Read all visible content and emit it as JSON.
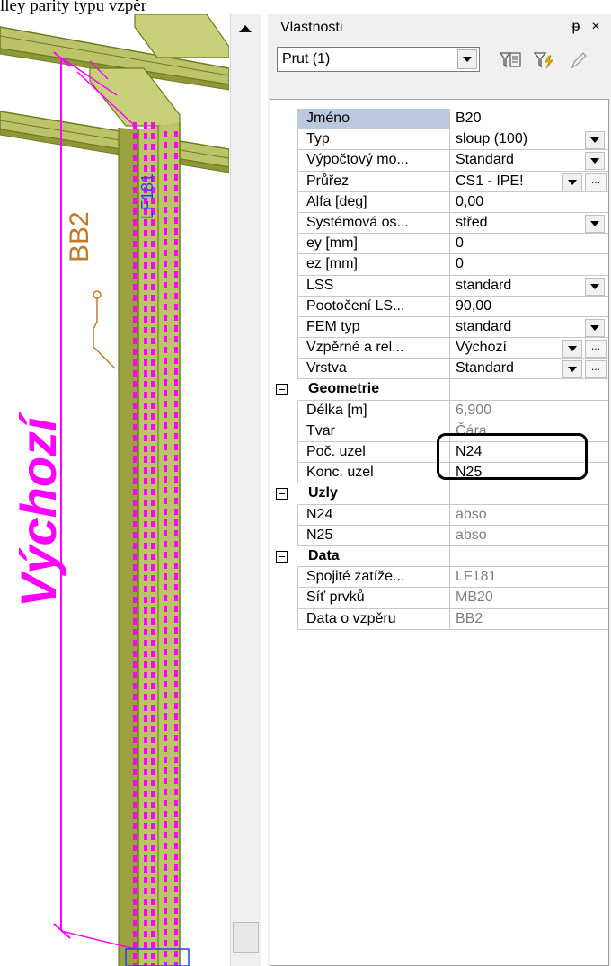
{
  "top_caption": "lley parity typu vzpěr",
  "viewport": {
    "labels": {
      "vychozi": "Výchozí",
      "bb2": "BB2",
      "lf181": "LF181"
    }
  },
  "panel": {
    "title": "Vlastnosti",
    "pin_glyph": "ᵽ",
    "close_glyph": "×",
    "selector_value": "Prut (1)",
    "toolbar_icons": [
      "filter-select-icon",
      "filter-lightning-icon",
      "pencil-icon"
    ]
  },
  "properties": [
    {
      "type": "prop",
      "name": "Jméno",
      "value": "B20",
      "selected": true
    },
    {
      "type": "prop",
      "name": "Typ",
      "value": "sloup (100)",
      "dropdown": true
    },
    {
      "type": "prop",
      "name": "Výpočtový mo...",
      "value": "Standard",
      "dropdown": true
    },
    {
      "type": "prop",
      "name": "Průřez",
      "value": "CS1 - IPE!",
      "dropdown": true,
      "ellipsis": true
    },
    {
      "type": "prop",
      "name": "Alfa [deg]",
      "value": "0,00"
    },
    {
      "type": "prop",
      "name": "Systémová os...",
      "value": "střed",
      "dropdown": true
    },
    {
      "type": "prop",
      "name": "ey [mm]",
      "value": "0"
    },
    {
      "type": "prop",
      "name": "ez [mm]",
      "value": "0"
    },
    {
      "type": "prop",
      "name": "LSS",
      "value": "standard",
      "dropdown": true
    },
    {
      "type": "prop",
      "name": "Pootočení LS...",
      "value": "90,00"
    },
    {
      "type": "prop",
      "name": "FEM typ",
      "value": "standard",
      "dropdown": true
    },
    {
      "type": "prop",
      "name": "Vzpěrné a rel...",
      "value": "Výchozí",
      "dropdown": true,
      "ellipsis": true
    },
    {
      "type": "prop",
      "name": "Vrstva",
      "value": "Standard",
      "dropdown": true,
      "ellipsis": true
    },
    {
      "type": "group",
      "name": "Geometrie"
    },
    {
      "type": "prop",
      "name": "Délka [m]",
      "value": "6,900",
      "readonly": true
    },
    {
      "type": "prop",
      "name": "Tvar",
      "value": "Čára",
      "readonly": true
    },
    {
      "type": "prop",
      "name": "Poč. uzel",
      "value": "N24"
    },
    {
      "type": "prop",
      "name": "Konc. uzel",
      "value": "N25"
    },
    {
      "type": "group",
      "name": "Uzly"
    },
    {
      "type": "prop",
      "name": "N24",
      "value": "abso",
      "readonly": true
    },
    {
      "type": "prop",
      "name": "N25",
      "value": "abso",
      "readonly": true
    },
    {
      "type": "group",
      "name": "Data"
    },
    {
      "type": "prop",
      "name": "Spojité zatíže...",
      "value": "LF181",
      "readonly": true
    },
    {
      "type": "prop",
      "name": "Síť prvků",
      "value": "MB20",
      "readonly": true
    },
    {
      "type": "prop",
      "name": "Data o vzpěru",
      "value": "BB2",
      "readonly": true
    }
  ],
  "colors": {
    "member_fill": "#bcc46a",
    "member_dark": "#6f7a1e",
    "magenta": "#ff00ff",
    "panel_bg": "#f0f0f0",
    "selected_name_bg": "#bcc8dd"
  }
}
